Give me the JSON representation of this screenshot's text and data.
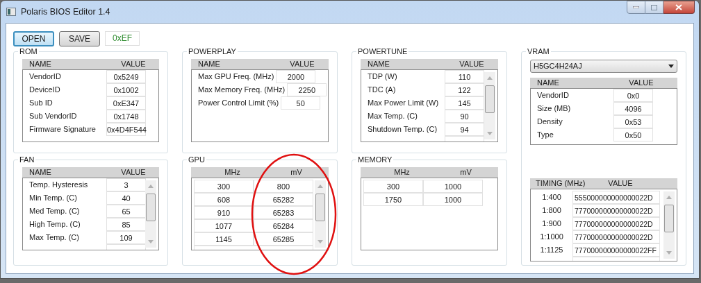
{
  "window": {
    "title": "Polaris BIOS Editor 1.4"
  },
  "toolbar": {
    "buttons": [
      {
        "label": "OPEN",
        "focused": true
      },
      {
        "label": "SAVE",
        "focused": false
      }
    ],
    "checksum": "0xEF"
  },
  "groups": [
    {
      "title": "ROM",
      "kind": "name_value",
      "columns": [
        "NAME",
        "VALUE"
      ],
      "scrollbar": false,
      "rows": [
        {
          "name": "VendorID",
          "value": "0x5249"
        },
        {
          "name": "DeviceID",
          "value": "0x1002"
        },
        {
          "name": "Sub ID",
          "value": "0xE347"
        },
        {
          "name": "Sub VendorID",
          "value": "0x1748"
        },
        {
          "name": "Firmware Signature",
          "value": "0x4D4F544"
        }
      ]
    },
    {
      "title": "POWERPLAY",
      "kind": "name_value",
      "columns": [
        "NAME",
        "VALUE"
      ],
      "scrollbar": false,
      "rows": [
        {
          "name": "Max GPU Freq. (MHz)",
          "value": "2000"
        },
        {
          "name": "Max Memory Freq. (MHz)",
          "value": "2250"
        },
        {
          "name": "Power Control Limit (%)",
          "value": "50"
        }
      ]
    },
    {
      "title": "POWERTUNE",
      "kind": "name_value",
      "columns": [
        "NAME",
        "VALUE"
      ],
      "scrollbar": true,
      "rows": [
        {
          "name": "TDP (W)",
          "value": "110"
        },
        {
          "name": "TDC (A)",
          "value": "122"
        },
        {
          "name": "Max Power Limit (W)",
          "value": "145"
        },
        {
          "name": "Max Temp. (C)",
          "value": "90"
        },
        {
          "name": "Shutdown Temp. (C)",
          "value": "94"
        }
      ]
    },
    {
      "title": "VRAM",
      "kind": "vram",
      "dropdown": "H5GC4H24AJ",
      "columns": [
        "NAME",
        "VALUE"
      ],
      "rows": [
        {
          "name": "VendorID",
          "value": "0x0"
        },
        {
          "name": "Size (MB)",
          "value": "4096"
        },
        {
          "name": "Density",
          "value": "0x53"
        },
        {
          "name": "Type",
          "value": "0x50"
        }
      ],
      "timing": {
        "columns": [
          "TIMING (MHz)",
          "VALUE"
        ],
        "scrollbar": true,
        "rows": [
          {
            "name": "1:400",
            "value": "555000000000000022D"
          },
          {
            "name": "1:800",
            "value": "777000000000000022D"
          },
          {
            "name": "1:900",
            "value": "777000000000000022D"
          },
          {
            "name": "1:1000",
            "value": "777000000000000022D"
          },
          {
            "name": "1:1125",
            "value": "777000000000000022FF"
          }
        ]
      }
    },
    {
      "title": "FAN",
      "kind": "name_value",
      "columns": [
        "NAME",
        "VALUE"
      ],
      "scrollbar": true,
      "rows": [
        {
          "name": "Temp. Hysteresis",
          "value": "3"
        },
        {
          "name": "Min Temp. (C)",
          "value": "40"
        },
        {
          "name": "Med Temp. (C)",
          "value": "65"
        },
        {
          "name": "High Temp. (C)",
          "value": "85"
        },
        {
          "name": "Max Temp. (C)",
          "value": "109"
        }
      ]
    },
    {
      "title": "GPU",
      "kind": "pair",
      "columns": [
        "MHz",
        "mV"
      ],
      "scrollbar": true,
      "rows": [
        {
          "mhz": "300",
          "mv": "800"
        },
        {
          "mhz": "608",
          "mv": "65282"
        },
        {
          "mhz": "910",
          "mv": "65283"
        },
        {
          "mhz": "1077",
          "mv": "65284"
        },
        {
          "mhz": "1145",
          "mv": "65285"
        }
      ]
    },
    {
      "title": "MEMORY",
      "kind": "pair",
      "columns": [
        "MHz",
        "mV"
      ],
      "scrollbar": false,
      "rows": [
        {
          "mhz": "300",
          "mv": "1000"
        },
        {
          "mhz": "1750",
          "mv": "1000"
        }
      ]
    }
  ],
  "annotation": {
    "kind": "ellipse",
    "color": "#e01010"
  }
}
